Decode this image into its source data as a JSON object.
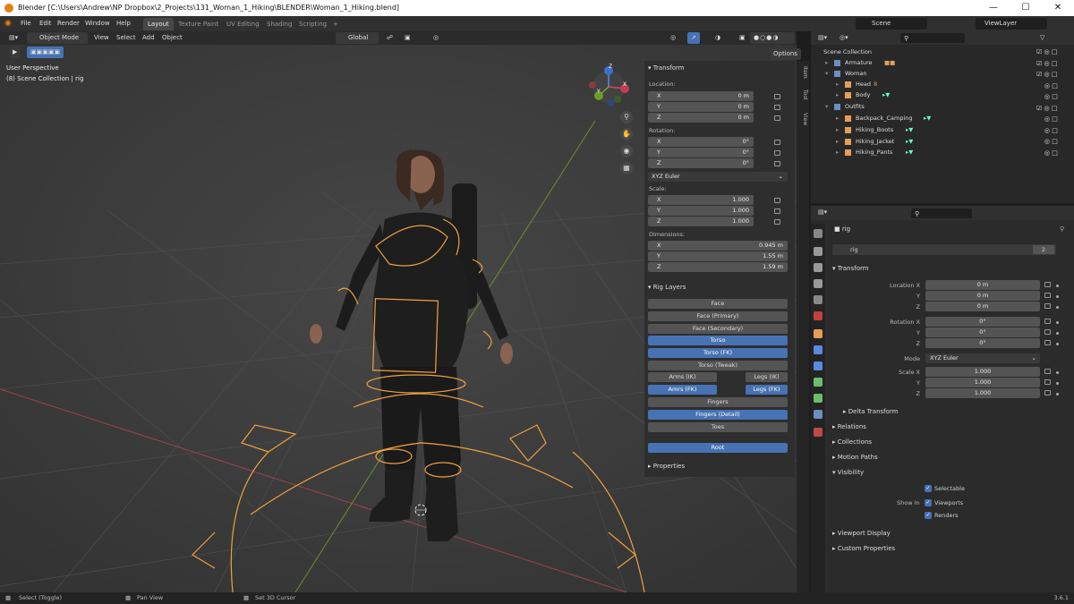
{
  "window": {
    "title": "Blender [C:\\Users\\Andrew\\NP Dropbox\\2_Projects\\131_Woman_1_Hiking\\BLENDER\\Woman_1_Hiking.blend]",
    "minimize": "—",
    "maximize": "☐",
    "close": "✕"
  },
  "menu": {
    "file": "File",
    "edit": "Edit",
    "render": "Render",
    "window": "Window",
    "help": "Help"
  },
  "workspaces": [
    "Layout",
    "Texture Paint",
    "UV Editing",
    "Shading",
    "Scripting",
    "+"
  ],
  "scene": {
    "label": "Scene",
    "viewlayer": "ViewLayer"
  },
  "viewport_header": {
    "mode": "Object Mode",
    "view": "View",
    "select": "Select",
    "add": "Add",
    "object": "Object",
    "orientation": "Global",
    "options": "Options"
  },
  "viewport_overlay": {
    "perspective": "User Perspective",
    "collection": "(8) Scene Collection | rig"
  },
  "gizmo": {
    "x": "X",
    "y": "Y",
    "z": "Z"
  },
  "npanel": {
    "transform_title": "Transform",
    "location_label": "Location:",
    "location": [
      {
        "axis": "X",
        "value": "0 m"
      },
      {
        "axis": "Y",
        "value": "0 m"
      },
      {
        "axis": "Z",
        "value": "0 m"
      }
    ],
    "rotation_label": "Rotation:",
    "rotation": [
      {
        "axis": "X",
        "value": "0°"
      },
      {
        "axis": "Y",
        "value": "0°"
      },
      {
        "axis": "Z",
        "value": "0°"
      }
    ],
    "rotation_mode": "XYZ Euler",
    "scale_label": "Scale:",
    "scale": [
      {
        "axis": "X",
        "value": "1.000"
      },
      {
        "axis": "Y",
        "value": "1.000"
      },
      {
        "axis": "Z",
        "value": "1.000"
      }
    ],
    "dimensions_label": "Dimensions:",
    "dimensions": [
      {
        "axis": "X",
        "value": "0.945 m"
      },
      {
        "axis": "Y",
        "value": "1.55 m"
      },
      {
        "axis": "Z",
        "value": "1.59 m"
      }
    ],
    "rig_layers_title": "Rig Layers",
    "rig": {
      "face": "Face",
      "face_primary": "Face (Primary)",
      "face_secondary": "Face (Secondary)",
      "torso": "Torso",
      "torso_fk": "Torso (FK)",
      "torso_tweak": "Torso (Tweak)",
      "arms_ik": "Arms (IK)",
      "legs_ik": "Legs (IK)",
      "arms_fk": "Amrs (FK)",
      "legs_fk": "Legs (FK)",
      "fingers": "Fingers",
      "fingers_detail": "Fingers (Detail)",
      "toes": "Toes",
      "root": "Root"
    },
    "properties_title": "Properties",
    "tabs": [
      "Item",
      "Tool",
      "View"
    ]
  },
  "outliner": {
    "root": "Scene Collection",
    "rows": [
      {
        "name": "Armature",
        "indent": 1
      },
      {
        "name": "Woman",
        "indent": 1
      },
      {
        "name": "Head",
        "indent": 2
      },
      {
        "name": "Body",
        "indent": 2
      },
      {
        "name": "Outfits",
        "indent": 1
      },
      {
        "name": "Backpack_Camping",
        "indent": 2
      },
      {
        "name": "Hiking_Boots",
        "indent": 2
      },
      {
        "name": "Hiking_Jacket",
        "indent": 2
      },
      {
        "name": "Hiking_Pants",
        "indent": 2
      }
    ],
    "head_badge": "8"
  },
  "properties": {
    "object_name": "rig",
    "data_name": "rig",
    "users": "2",
    "transform_title": "Transform",
    "location_label": "Location X",
    "location": [
      "0 m",
      "0 m",
      "0 m"
    ],
    "rotation_label": "Rotation X",
    "rotation": [
      "0°",
      "0°",
      "0°"
    ],
    "mode_label": "Mode",
    "mode": "XYZ Euler",
    "scale_label": "Scale X",
    "scale": [
      "1.000",
      "1.000",
      "1.000"
    ],
    "y": "Y",
    "z": "Z",
    "delta": "Delta Transform",
    "relations": "Relations",
    "collections": "Collections",
    "motion_paths": "Motion Paths",
    "visibility": "Visibility",
    "selectable": "Selectable",
    "show_in": "Show In",
    "viewports": "Viewports",
    "renders": "Renders",
    "viewport_display": "Viewport Display",
    "custom_properties": "Custom Properties"
  },
  "status": {
    "select": "Select (Toggle)",
    "pan": "Pan View",
    "cursor": "Set 3D Cursor",
    "version": "3.6.1"
  }
}
